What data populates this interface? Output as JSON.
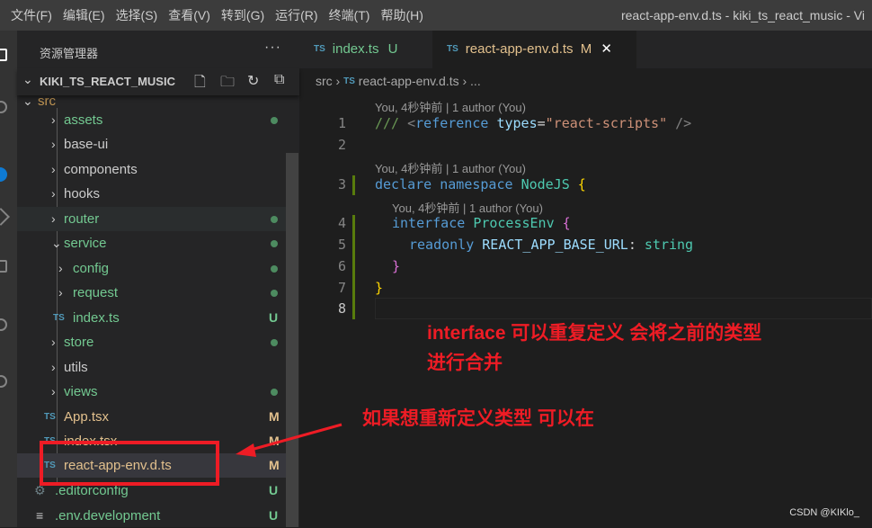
{
  "menu": [
    "文件(F)",
    "编辑(E)",
    "选择(S)",
    "查看(V)",
    "转到(G)",
    "运行(R)",
    "终端(T)",
    "帮助(H)"
  ],
  "window_title": "react-app-env.d.ts - kiki_ts_react_music - Vi",
  "sidebar": {
    "title": "资源管理器",
    "more": "···",
    "project": "KIKI_TS_REACT_MUSIC",
    "tree": [
      {
        "name": "src",
        "type": "folder",
        "open": true,
        "color": "#c09553",
        "status": ""
      },
      {
        "name": "assets",
        "type": "folder",
        "color": "#73c991",
        "status": "dot"
      },
      {
        "name": "base-ui",
        "type": "folder",
        "color": "#cccccc",
        "status": ""
      },
      {
        "name": "components",
        "type": "folder",
        "color": "#cccccc",
        "status": ""
      },
      {
        "name": "hooks",
        "type": "folder",
        "color": "#cccccc",
        "status": ""
      },
      {
        "name": "router",
        "type": "folder",
        "color": "#73c991",
        "status": "dot"
      },
      {
        "name": "service",
        "type": "folder",
        "open": true,
        "color": "#73c991",
        "status": "dot"
      },
      {
        "name": "config",
        "type": "folder",
        "color": "#73c991",
        "status": "dot"
      },
      {
        "name": "request",
        "type": "folder",
        "color": "#73c991",
        "status": "dot"
      },
      {
        "name": "index.ts",
        "type": "ts",
        "color": "#73c991",
        "status": "U"
      },
      {
        "name": "store",
        "type": "folder",
        "color": "#73c991",
        "status": "dot"
      },
      {
        "name": "utils",
        "type": "folder",
        "color": "#cccccc",
        "status": ""
      },
      {
        "name": "views",
        "type": "folder",
        "color": "#73c991",
        "status": "dot"
      },
      {
        "name": "App.tsx",
        "type": "ts",
        "color": "#e2c08d",
        "status": "M"
      },
      {
        "name": "index.tsx",
        "type": "ts",
        "color": "#e2c08d",
        "status": "M"
      },
      {
        "name": "react-app-env.d.ts",
        "type": "ts",
        "color": "#e2c08d",
        "status": "M",
        "selected": true
      },
      {
        "name": ".editorconfig",
        "type": "gear",
        "color": "#73c991",
        "status": "U"
      },
      {
        "name": ".env.development",
        "type": "lines",
        "color": "#73c991",
        "status": "U"
      }
    ]
  },
  "tabs": [
    {
      "icon": "TS",
      "label": "index.ts",
      "status": "U"
    },
    {
      "icon": "TS",
      "label": "react-app-env.d.ts",
      "status": "M",
      "close": "✕",
      "active": true
    }
  ],
  "breadcrumb": {
    "folder": "src",
    "file": "react-app-env.d.ts",
    "more": "..."
  },
  "codelens": "You, 4秒钟前 | 1 author (You)",
  "line_numbers": [
    "1",
    "2",
    "3",
    "4",
    "5",
    "6",
    "7",
    "8"
  ],
  "annotations": {
    "note1_line1": "interface 可以重复定义 会将之前的类型",
    "note1_line2": "进行合并",
    "note2": "如果想重新定义类型 可以在"
  },
  "watermark": "CSDN @KIKlo_",
  "colors": {
    "untracked": "#73c991",
    "modified": "#e2c08d",
    "annotation": "#ee1c25"
  }
}
